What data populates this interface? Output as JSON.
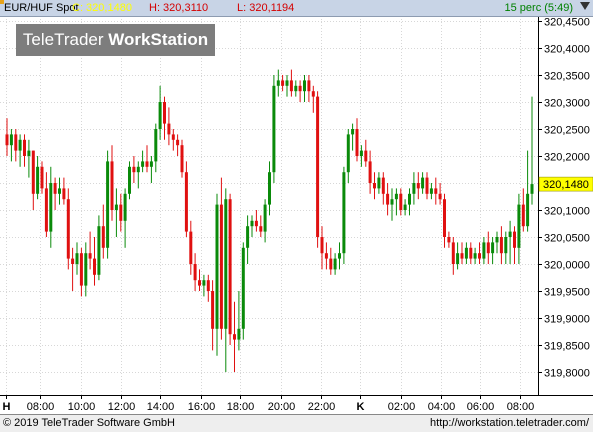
{
  "header": {
    "symbol": "EUR/HUF Spot",
    "close": "C: 320,1480",
    "high": "H: 320,3110",
    "low": "L: 320,1194",
    "period": "15 perc (5:49)"
  },
  "logo": {
    "part1": "TeleTrader",
    "part2": "WorkStation"
  },
  "footer": {
    "copyright": "© 2019  TeleTrader Software GmbH",
    "website": "http://workstation.teletrader.com/"
  },
  "colors": {
    "up": "#0a8a0a",
    "down": "#e01010",
    "panel": "#c8d4e6",
    "price_tag": "#ffff00"
  },
  "icons": [
    "corner-marker-icon",
    "scroll-arrow-icon"
  ],
  "chart_data": {
    "type": "candlestick",
    "ylim": [
      319.76,
      320.48
    ],
    "yticks": [
      "320,4500",
      "320,4000",
      "320,3500",
      "320,3000",
      "320,2500",
      "320,2000",
      "320,1500",
      "320,1000",
      "320,0500",
      "320,0000",
      "319,9500",
      "319,9000",
      "319,8500",
      "319,8000"
    ],
    "ytick_values": [
      320.45,
      320.4,
      320.35,
      320.3,
      320.25,
      320.2,
      320.15,
      320.1,
      320.05,
      320.0,
      319.95,
      319.9,
      319.85,
      319.8
    ],
    "xticks": [
      "H",
      "08:00",
      "10:00",
      "12:00",
      "14:00",
      "16:00",
      "18:00",
      "20:00",
      "22:00",
      "K",
      "02:00",
      "04:00",
      "06:00",
      "08:00"
    ],
    "last_price_label": "320,1480",
    "last_price": 320.148,
    "candles": [
      {
        "o": 320.24,
        "h": 320.27,
        "l": 320.2,
        "c": 320.22
      },
      {
        "o": 320.22,
        "h": 320.25,
        "l": 320.19,
        "c": 320.24
      },
      {
        "o": 320.24,
        "h": 320.25,
        "l": 320.19,
        "c": 320.21
      },
      {
        "o": 320.21,
        "h": 320.24,
        "l": 320.18,
        "c": 320.23
      },
      {
        "o": 320.23,
        "h": 320.24,
        "l": 320.18,
        "c": 320.2
      },
      {
        "o": 320.2,
        "h": 320.23,
        "l": 320.16,
        "c": 320.21
      },
      {
        "o": 320.21,
        "h": 320.21,
        "l": 320.1,
        "c": 320.13
      },
      {
        "o": 320.13,
        "h": 320.2,
        "l": 320.12,
        "c": 320.18
      },
      {
        "o": 320.18,
        "h": 320.19,
        "l": 320.13,
        "c": 320.14
      },
      {
        "o": 320.14,
        "h": 320.17,
        "l": 320.05,
        "c": 320.06
      },
      {
        "o": 320.06,
        "h": 320.18,
        "l": 320.03,
        "c": 320.15
      },
      {
        "o": 320.15,
        "h": 320.16,
        "l": 320.1,
        "c": 320.13
      },
      {
        "o": 320.13,
        "h": 320.16,
        "l": 320.11,
        "c": 320.14
      },
      {
        "o": 320.14,
        "h": 320.16,
        "l": 320.11,
        "c": 320.12
      },
      {
        "o": 320.12,
        "h": 320.14,
        "l": 319.99,
        "c": 320.01
      },
      {
        "o": 320.01,
        "h": 320.03,
        "l": 319.95,
        "c": 320.0
      },
      {
        "o": 320.0,
        "h": 320.04,
        "l": 319.98,
        "c": 320.02
      },
      {
        "o": 320.02,
        "h": 320.03,
        "l": 319.94,
        "c": 319.96
      },
      {
        "o": 319.96,
        "h": 320.04,
        "l": 319.94,
        "c": 320.02
      },
      {
        "o": 320.02,
        "h": 320.06,
        "l": 319.99,
        "c": 320.01
      },
      {
        "o": 320.01,
        "h": 320.05,
        "l": 319.96,
        "c": 319.98
      },
      {
        "o": 319.98,
        "h": 320.09,
        "l": 319.97,
        "c": 320.07
      },
      {
        "o": 320.07,
        "h": 320.11,
        "l": 320.01,
        "c": 320.03
      },
      {
        "o": 320.03,
        "h": 320.21,
        "l": 320.01,
        "c": 320.19
      },
      {
        "o": 320.19,
        "h": 320.22,
        "l": 320.08,
        "c": 320.1
      },
      {
        "o": 320.1,
        "h": 320.14,
        "l": 320.05,
        "c": 320.11
      },
      {
        "o": 320.11,
        "h": 320.13,
        "l": 320.06,
        "c": 320.08
      },
      {
        "o": 320.08,
        "h": 320.14,
        "l": 320.03,
        "c": 320.13
      },
      {
        "o": 320.13,
        "h": 320.19,
        "l": 320.12,
        "c": 320.18
      },
      {
        "o": 320.18,
        "h": 320.2,
        "l": 320.15,
        "c": 320.17
      },
      {
        "o": 320.17,
        "h": 320.19,
        "l": 320.14,
        "c": 320.18
      },
      {
        "o": 320.18,
        "h": 320.21,
        "l": 320.17,
        "c": 320.19
      },
      {
        "o": 320.19,
        "h": 320.22,
        "l": 320.17,
        "c": 320.18
      },
      {
        "o": 320.18,
        "h": 320.2,
        "l": 320.15,
        "c": 320.19
      },
      {
        "o": 320.19,
        "h": 320.26,
        "l": 320.17,
        "c": 320.25
      },
      {
        "o": 320.25,
        "h": 320.33,
        "l": 320.23,
        "c": 320.3
      },
      {
        "o": 320.3,
        "h": 320.31,
        "l": 320.23,
        "c": 320.26
      },
      {
        "o": 320.26,
        "h": 320.29,
        "l": 320.22,
        "c": 320.24
      },
      {
        "o": 320.24,
        "h": 320.25,
        "l": 320.21,
        "c": 320.23
      },
      {
        "o": 320.23,
        "h": 320.24,
        "l": 320.2,
        "c": 320.22
      },
      {
        "o": 320.22,
        "h": 320.23,
        "l": 320.16,
        "c": 320.17
      },
      {
        "o": 320.17,
        "h": 320.19,
        "l": 320.05,
        "c": 320.06
      },
      {
        "o": 320.06,
        "h": 320.08,
        "l": 319.98,
        "c": 320.0
      },
      {
        "o": 320.0,
        "h": 320.02,
        "l": 319.95,
        "c": 319.97
      },
      {
        "o": 319.97,
        "h": 319.99,
        "l": 319.95,
        "c": 319.96
      },
      {
        "o": 319.96,
        "h": 319.98,
        "l": 319.94,
        "c": 319.97
      },
      {
        "o": 319.97,
        "h": 319.98,
        "l": 319.93,
        "c": 319.95
      },
      {
        "o": 319.95,
        "h": 319.97,
        "l": 319.84,
        "c": 319.88
      },
      {
        "o": 319.88,
        "h": 320.13,
        "l": 319.83,
        "c": 320.11
      },
      {
        "o": 320.11,
        "h": 320.16,
        "l": 319.86,
        "c": 319.88
      },
      {
        "o": 319.88,
        "h": 320.14,
        "l": 319.8,
        "c": 320.12
      },
      {
        "o": 320.12,
        "h": 320.13,
        "l": 319.85,
        "c": 319.87
      },
      {
        "o": 319.87,
        "h": 319.93,
        "l": 319.8,
        "c": 319.86
      },
      {
        "o": 319.86,
        "h": 319.95,
        "l": 319.84,
        "c": 319.88
      },
      {
        "o": 319.88,
        "h": 320.04,
        "l": 319.86,
        "c": 320.03
      },
      {
        "o": 320.03,
        "h": 320.09,
        "l": 320.0,
        "c": 320.07
      },
      {
        "o": 320.07,
        "h": 320.09,
        "l": 320.05,
        "c": 320.08
      },
      {
        "o": 320.08,
        "h": 320.1,
        "l": 320.06,
        "c": 320.07
      },
      {
        "o": 320.07,
        "h": 320.09,
        "l": 320.05,
        "c": 320.06
      },
      {
        "o": 320.06,
        "h": 320.12,
        "l": 320.04,
        "c": 320.11
      },
      {
        "o": 320.11,
        "h": 320.19,
        "l": 320.09,
        "c": 320.17
      },
      {
        "o": 320.17,
        "h": 320.35,
        "l": 320.15,
        "c": 320.33
      },
      {
        "o": 320.33,
        "h": 320.36,
        "l": 320.31,
        "c": 320.34
      },
      {
        "o": 320.34,
        "h": 320.35,
        "l": 320.32,
        "c": 320.33
      },
      {
        "o": 320.33,
        "h": 320.35,
        "l": 320.31,
        "c": 320.34
      },
      {
        "o": 320.34,
        "h": 320.36,
        "l": 320.31,
        "c": 320.32
      },
      {
        "o": 320.32,
        "h": 320.34,
        "l": 320.31,
        "c": 320.33
      },
      {
        "o": 320.33,
        "h": 320.34,
        "l": 320.3,
        "c": 320.32
      },
      {
        "o": 320.32,
        "h": 320.35,
        "l": 320.3,
        "c": 320.34
      },
      {
        "o": 320.34,
        "h": 320.35,
        "l": 320.3,
        "c": 320.32
      },
      {
        "o": 320.32,
        "h": 320.33,
        "l": 320.28,
        "c": 320.31
      },
      {
        "o": 320.31,
        "h": 320.32,
        "l": 320.03,
        "c": 320.05
      },
      {
        "o": 320.05,
        "h": 320.07,
        "l": 319.99,
        "c": 320.02
      },
      {
        "o": 320.02,
        "h": 320.04,
        "l": 319.99,
        "c": 320.01
      },
      {
        "o": 320.01,
        "h": 320.03,
        "l": 319.98,
        "c": 319.99
      },
      {
        "o": 319.99,
        "h": 320.02,
        "l": 319.98,
        "c": 320.01
      },
      {
        "o": 320.01,
        "h": 320.04,
        "l": 319.99,
        "c": 320.02
      },
      {
        "o": 320.02,
        "h": 320.18,
        "l": 320.0,
        "c": 320.17
      },
      {
        "o": 320.17,
        "h": 320.25,
        "l": 320.15,
        "c": 320.24
      },
      {
        "o": 320.24,
        "h": 320.26,
        "l": 320.21,
        "c": 320.25
      },
      {
        "o": 320.25,
        "h": 320.27,
        "l": 320.19,
        "c": 320.2
      },
      {
        "o": 320.2,
        "h": 320.22,
        "l": 320.18,
        "c": 320.21
      },
      {
        "o": 320.21,
        "h": 320.23,
        "l": 320.18,
        "c": 320.19
      },
      {
        "o": 320.19,
        "h": 320.21,
        "l": 320.13,
        "c": 320.15
      },
      {
        "o": 320.15,
        "h": 320.17,
        "l": 320.12,
        "c": 320.14
      },
      {
        "o": 320.14,
        "h": 320.17,
        "l": 320.13,
        "c": 320.16
      },
      {
        "o": 320.16,
        "h": 320.17,
        "l": 320.11,
        "c": 320.13
      },
      {
        "o": 320.13,
        "h": 320.15,
        "l": 320.09,
        "c": 320.11
      },
      {
        "o": 320.11,
        "h": 320.14,
        "l": 320.08,
        "c": 320.12
      },
      {
        "o": 320.12,
        "h": 320.14,
        "l": 320.09,
        "c": 320.13
      },
      {
        "o": 320.13,
        "h": 320.14,
        "l": 320.09,
        "c": 320.1
      },
      {
        "o": 320.1,
        "h": 320.12,
        "l": 320.09,
        "c": 320.11
      },
      {
        "o": 320.11,
        "h": 320.14,
        "l": 320.09,
        "c": 320.13
      },
      {
        "o": 320.13,
        "h": 320.17,
        "l": 320.11,
        "c": 320.15
      },
      {
        "o": 320.15,
        "h": 320.17,
        "l": 320.12,
        "c": 320.14
      },
      {
        "o": 320.14,
        "h": 320.17,
        "l": 320.13,
        "c": 320.16
      },
      {
        "o": 320.16,
        "h": 320.17,
        "l": 320.12,
        "c": 320.13
      },
      {
        "o": 320.13,
        "h": 320.15,
        "l": 320.12,
        "c": 320.14
      },
      {
        "o": 320.14,
        "h": 320.16,
        "l": 320.11,
        "c": 320.13
      },
      {
        "o": 320.13,
        "h": 320.15,
        "l": 320.11,
        "c": 320.12
      },
      {
        "o": 320.12,
        "h": 320.13,
        "l": 320.03,
        "c": 320.05
      },
      {
        "o": 320.05,
        "h": 320.06,
        "l": 320.03,
        "c": 320.04
      },
      {
        "o": 320.04,
        "h": 320.05,
        "l": 319.98,
        "c": 320.0
      },
      {
        "o": 320.0,
        "h": 320.04,
        "l": 319.99,
        "c": 320.02
      },
      {
        "o": 320.02,
        "h": 320.04,
        "l": 320.0,
        "c": 320.01
      },
      {
        "o": 320.01,
        "h": 320.04,
        "l": 320.0,
        "c": 320.03
      },
      {
        "o": 320.03,
        "h": 320.04,
        "l": 320.0,
        "c": 320.01
      },
      {
        "o": 320.01,
        "h": 320.03,
        "l": 320.0,
        "c": 320.02
      },
      {
        "o": 320.02,
        "h": 320.04,
        "l": 320.0,
        "c": 320.01
      },
      {
        "o": 320.01,
        "h": 320.05,
        "l": 320.0,
        "c": 320.04
      },
      {
        "o": 320.04,
        "h": 320.06,
        "l": 320.0,
        "c": 320.02
      },
      {
        "o": 320.02,
        "h": 320.05,
        "l": 320.0,
        "c": 320.04
      },
      {
        "o": 320.04,
        "h": 320.06,
        "l": 320.02,
        "c": 320.05
      },
      {
        "o": 320.05,
        "h": 320.07,
        "l": 320.0,
        "c": 320.02
      },
      {
        "o": 320.02,
        "h": 320.06,
        "l": 320.0,
        "c": 320.05
      },
      {
        "o": 320.05,
        "h": 320.08,
        "l": 320.0,
        "c": 320.06
      },
      {
        "o": 320.06,
        "h": 320.07,
        "l": 320.0,
        "c": 320.03
      },
      {
        "o": 320.03,
        "h": 320.13,
        "l": 320.0,
        "c": 320.11
      },
      {
        "o": 320.11,
        "h": 320.14,
        "l": 320.06,
        "c": 320.07
      },
      {
        "o": 320.07,
        "h": 320.21,
        "l": 320.06,
        "c": 320.13
      },
      {
        "o": 320.13,
        "h": 320.31,
        "l": 320.11,
        "c": 320.148
      }
    ]
  }
}
